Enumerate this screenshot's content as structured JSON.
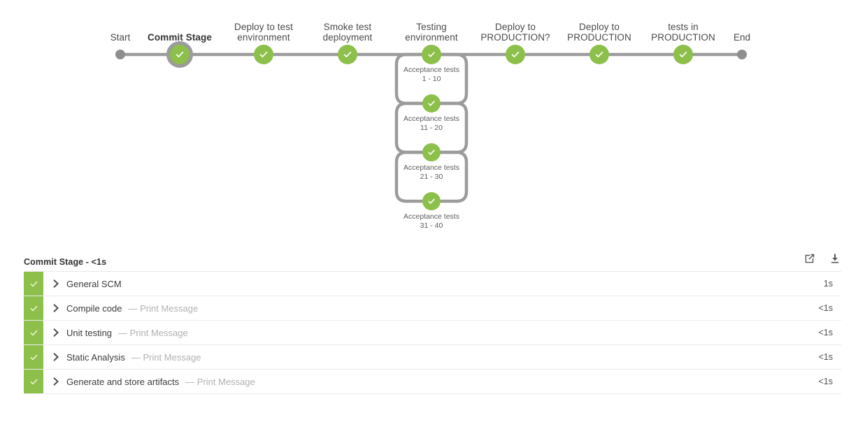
{
  "colors": {
    "success_green": "#8cc04a",
    "node_green": "#8cc04a",
    "connector_gray": "#9b9b9b",
    "endpoint_gray": "#8e8e8e",
    "selected_ring": "#9b9b9b",
    "row_divider": "#ececec",
    "muted_text": "#b1b1b1"
  },
  "pipeline": {
    "start_label": "Start",
    "end_label": "End",
    "stages": [
      {
        "label": "Commit Stage",
        "selected": true,
        "status": "success",
        "status_icon": "check-icon"
      },
      {
        "label": "Deploy to test\nenvironment",
        "selected": false,
        "status": "success",
        "status_icon": "check-icon"
      },
      {
        "label": "Smoke test\ndeployment",
        "selected": false,
        "status": "success",
        "status_icon": "check-icon"
      },
      {
        "label": "Testing\nenvironment",
        "selected": false,
        "status": "success",
        "status_icon": "check-icon"
      },
      {
        "label": "Deploy to\nPRODUCTION?",
        "selected": false,
        "status": "success",
        "status_icon": "check-icon"
      },
      {
        "label": "Deploy to\nPRODUCTION",
        "selected": false,
        "status": "success",
        "status_icon": "check-icon"
      },
      {
        "label": "tests in\nPRODUCTION",
        "selected": false,
        "status": "success",
        "status_icon": "check-icon"
      }
    ],
    "parallel_branch": {
      "parent_stage": "Testing environment",
      "nodes": [
        {
          "label": "Acceptance tests\n1 - 10",
          "status": "success",
          "status_icon": "check-icon"
        },
        {
          "label": "Acceptance tests\n11 - 20",
          "status": "success",
          "status_icon": "check-icon"
        },
        {
          "label": "Acceptance tests\n21 - 30",
          "status": "success",
          "status_icon": "check-icon"
        },
        {
          "label": "Acceptance tests\n31 - 40",
          "status": "success",
          "status_icon": "check-icon"
        }
      ]
    }
  },
  "detail": {
    "title": "Commit Stage - <1s",
    "actions": [
      {
        "name": "open-in-new-icon",
        "label": "Open in new window"
      },
      {
        "name": "download-icon",
        "label": "Download logs"
      }
    ],
    "steps": [
      {
        "status": "success",
        "status_icon": "check-icon",
        "expand_icon": "chevron-right-icon",
        "name": "General SCM",
        "note": "",
        "duration": "1s"
      },
      {
        "status": "success",
        "status_icon": "check-icon",
        "expand_icon": "chevron-right-icon",
        "name": "Compile code",
        "note": "— Print Message",
        "duration": "<1s"
      },
      {
        "status": "success",
        "status_icon": "check-icon",
        "expand_icon": "chevron-right-icon",
        "name": "Unit testing",
        "note": "— Print Message",
        "duration": "<1s"
      },
      {
        "status": "success",
        "status_icon": "check-icon",
        "expand_icon": "chevron-right-icon",
        "name": "Static Analysis",
        "note": "— Print Message",
        "duration": "<1s"
      },
      {
        "status": "success",
        "status_icon": "check-icon",
        "expand_icon": "chevron-right-icon",
        "name": "Generate and store artifacts",
        "note": "— Print Message",
        "duration": "<1s"
      }
    ]
  }
}
